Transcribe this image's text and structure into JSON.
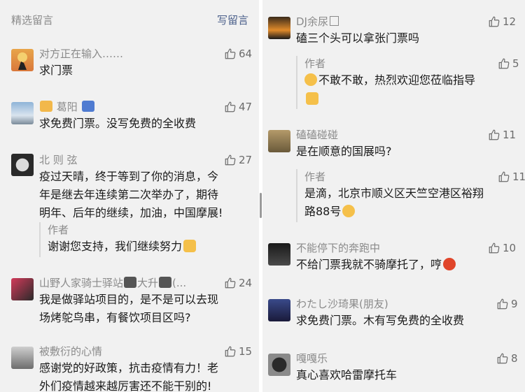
{
  "header": {
    "title": "精选留言",
    "write_link": "写留言"
  },
  "left_comments": [
    {
      "nick": "对方正在输入……",
      "text": "求门票",
      "likes": "64"
    },
    {
      "nick": "葛阳",
      "text": "求免费门票。没写免费的全收费",
      "likes": "47"
    },
    {
      "nick": "北 则 弦",
      "text_lines": [
        "疫过天晴，终于等到了你的消息，今",
        "年是继去年连续第二次举办了，期待",
        "明年、后年的继续，加油，中国摩展!"
      ],
      "likes": "27",
      "reply": {
        "who": "作者",
        "text": "谢谢您支持，我们继续努力"
      }
    },
    {
      "nick": "山野人家骑士驿站",
      "nick_extra": "大升",
      "nick_tail": "(...",
      "text_lines": [
        "我是做驿站项目的，是不是可以去现",
        "场烤鸵鸟串，有餐饮项目区吗?"
      ],
      "likes": "24"
    },
    {
      "nick": "被敷衍的心情",
      "text_lines": [
        "感谢党的好政策，抗击疫情有力！老",
        "外们疫情越来越厉害还不能干别的!"
      ],
      "likes": "15"
    }
  ],
  "right_comments": [
    {
      "nick": "DJ余尿",
      "text": "磕三个头可以拿张门票吗",
      "likes": "12",
      "reply": {
        "who": "作者",
        "text": "不敢不敢，热烈欢迎您莅临指导",
        "likes": "5"
      }
    },
    {
      "nick": "磕磕碰碰",
      "text": "是在顺意的国展吗?",
      "likes": "11",
      "reply": {
        "who": "作者",
        "text_lines": [
          "是滴，北京市顺义区天竺空港区裕翔",
          "路88号"
        ],
        "likes": "11"
      }
    },
    {
      "nick": "不能停下的奔跑中",
      "text": "不给门票我就不骑摩托了，哼",
      "likes": "10"
    },
    {
      "nick": "わたし沙琦果(朋友)",
      "text": "求免费门票。木有写免费的全收费",
      "likes": "9"
    },
    {
      "nick": "嘎嘎乐",
      "text": "真心喜欢哈雷摩托车",
      "likes": "8"
    }
  ],
  "colors": {
    "panel_bg": "#f1f1f1",
    "link": "#4a5f8a",
    "nick": "#8a8a8a",
    "text": "#1a1a1a"
  },
  "icons": {
    "like": "thumbs-up-icon"
  }
}
